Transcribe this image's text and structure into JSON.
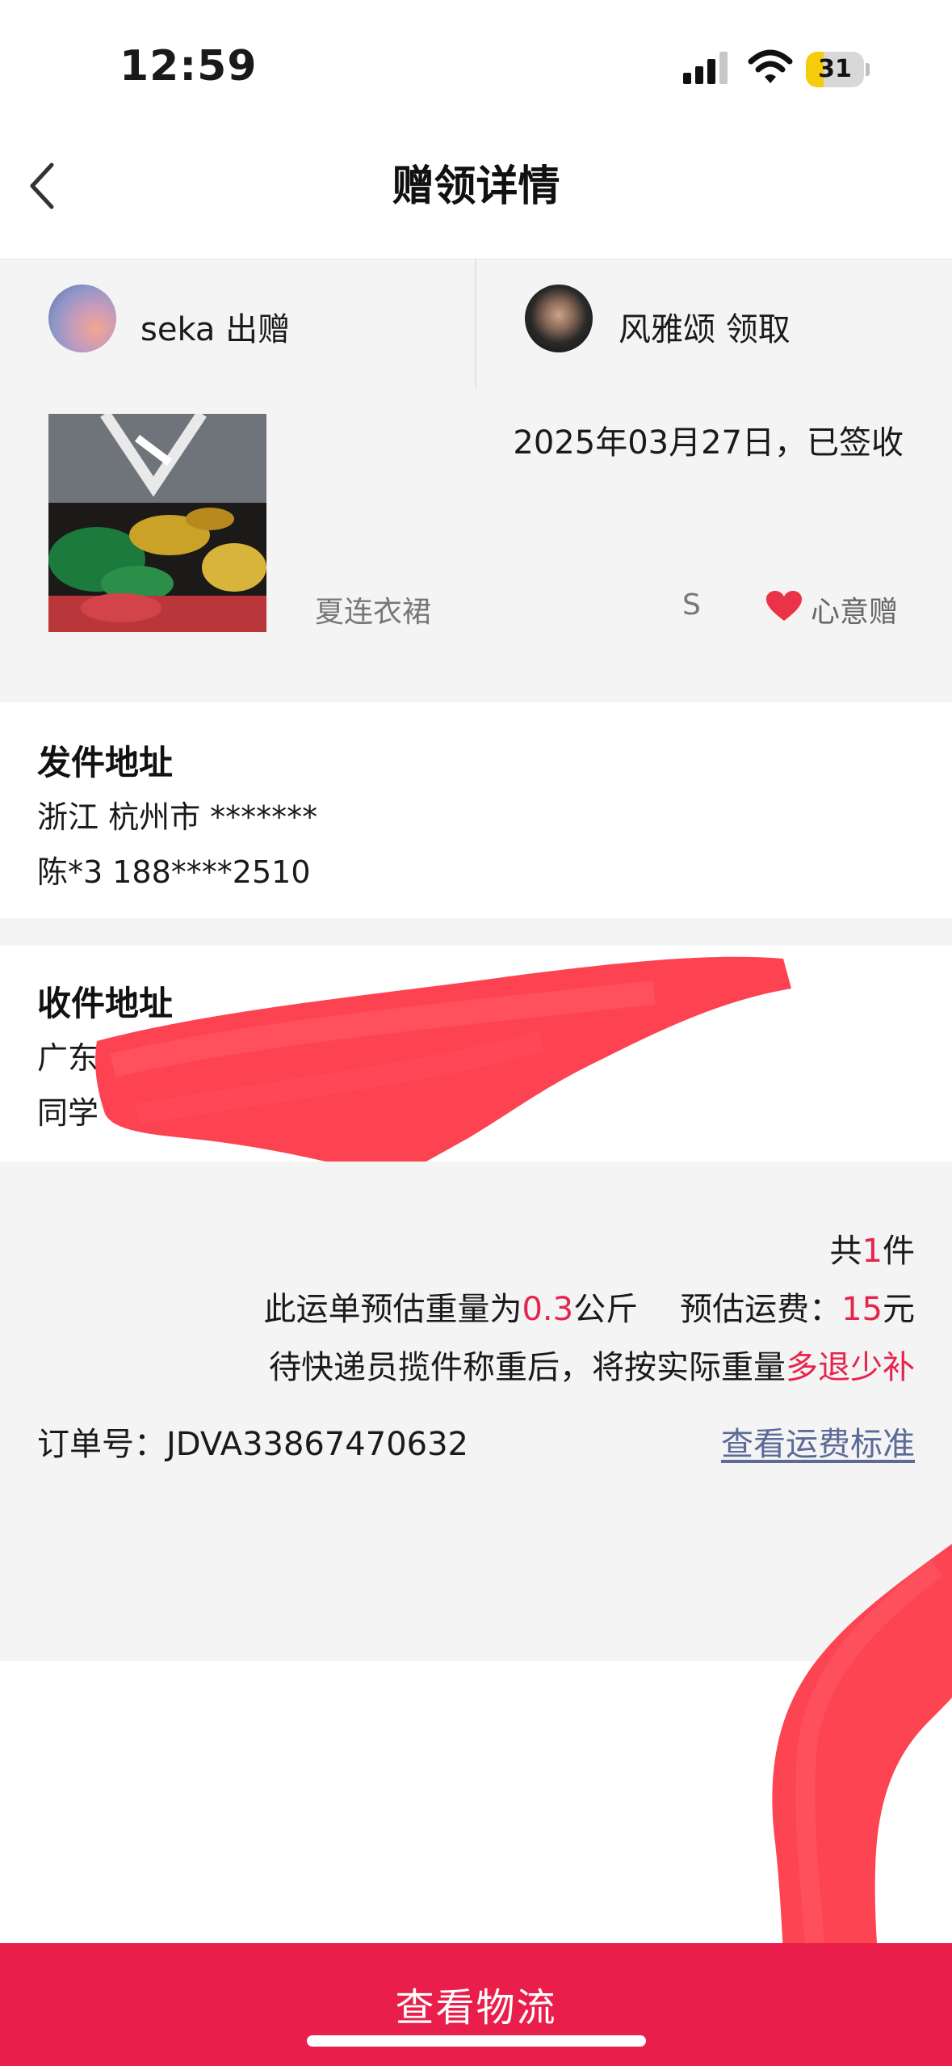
{
  "status_bar": {
    "time": "12:59",
    "battery": "31",
    "battery_level": 0.31,
    "battery_color": "#f6cc0a"
  },
  "nav": {
    "title": "赠领详情",
    "back_icon": "chevron-left-icon"
  },
  "people": {
    "giver": "seka 出赠",
    "receiver": "风雅颂 领取"
  },
  "item": {
    "date_status": "2025年03月27日，已签收",
    "name": "夏连衣裙",
    "size": "S",
    "gift_type": "心意赠",
    "heart_icon": "heart-icon",
    "heart_color": "#ea3346"
  },
  "sender": {
    "title": "发件地址",
    "region": "浙江 杭州市 *******",
    "contact": "陈*3 188****2510"
  },
  "receiver_address": {
    "title": "收件地址",
    "region": "广东",
    "contact": "同学"
  },
  "summary": {
    "count_prefix": "共",
    "count": "1",
    "count_suffix": "件",
    "weight_prefix": "此运单预估重量为",
    "weight": "0.3",
    "weight_unit": "公斤",
    "fee_prefix": "预估运费：",
    "fee": "15",
    "fee_unit": "元",
    "refund_prefix": "待快递员揽件称重后，将按实际重量",
    "refund_highlight": "多退少补",
    "order_label": "订单号：",
    "order_no": "JDVA33867470632",
    "fee_standard_link": "查看运费标准",
    "accent_color": "#e8234c"
  },
  "bottom_button": {
    "label": "查看物流",
    "color": "#e91e4a"
  }
}
